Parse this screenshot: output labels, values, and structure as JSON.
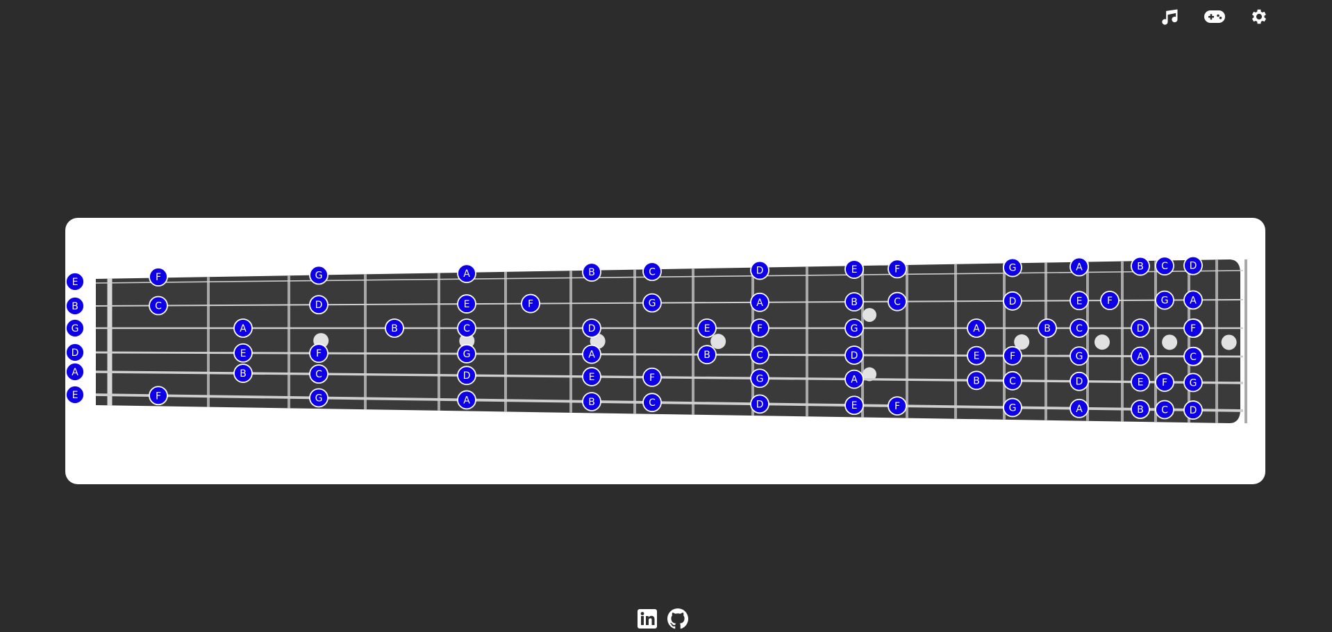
{
  "toolbar": {
    "items": [
      {
        "name": "music-note-icon",
        "label": ""
      },
      {
        "name": "gamepad-icon",
        "label": ""
      },
      {
        "name": "gear-icon",
        "label": ""
      }
    ]
  },
  "fretboard": {
    "open_strings": [
      "E",
      "B",
      "G",
      "D",
      "A",
      "E"
    ],
    "note_color": "#0d00e6",
    "frets": [
      [
        "F",
        "C",
        null,
        null,
        null,
        "F"
      ],
      [
        null,
        null,
        "A",
        "E",
        "B",
        null
      ],
      [
        "G",
        "D",
        null,
        "F",
        "C",
        "G"
      ],
      [
        null,
        null,
        "B",
        null,
        null,
        null
      ],
      [
        "A",
        "E",
        "C",
        "G",
        "D",
        "A"
      ],
      [
        null,
        "F",
        null,
        null,
        null,
        null
      ],
      [
        "B",
        null,
        "D",
        "A",
        "E",
        "B"
      ],
      [
        "C",
        "G",
        null,
        null,
        "F",
        "C"
      ],
      [
        null,
        null,
        "E",
        "B",
        null,
        null
      ],
      [
        "D",
        "A",
        "F",
        "C",
        "G",
        "D"
      ],
      [
        null,
        null,
        null,
        null,
        null,
        null
      ],
      [
        "E",
        "B",
        "G",
        "D",
        "A",
        "E"
      ],
      [
        "F",
        "C",
        null,
        null,
        null,
        "F"
      ],
      [
        null,
        null,
        "A",
        "E",
        "B",
        null
      ],
      [
        "G",
        "D",
        null,
        "F",
        "C",
        "G"
      ],
      [
        null,
        null,
        "B",
        null,
        null,
        null
      ],
      [
        "A",
        "E",
        "C",
        "G",
        "D",
        "A"
      ],
      [
        null,
        "F",
        null,
        null,
        null,
        null
      ],
      [
        "B",
        null,
        "D",
        "A",
        "E",
        "B"
      ],
      [
        "C",
        "G",
        null,
        null,
        "F",
        "C"
      ],
      [
        null,
        null,
        "E",
        "B",
        null,
        null
      ],
      [
        "D",
        "A",
        "F",
        "C",
        "G",
        "D"
      ]
    ]
  },
  "footer": {
    "links": [
      {
        "name": "linkedin-icon",
        "label": "in"
      },
      {
        "name": "github-icon",
        "label": ""
      }
    ]
  }
}
